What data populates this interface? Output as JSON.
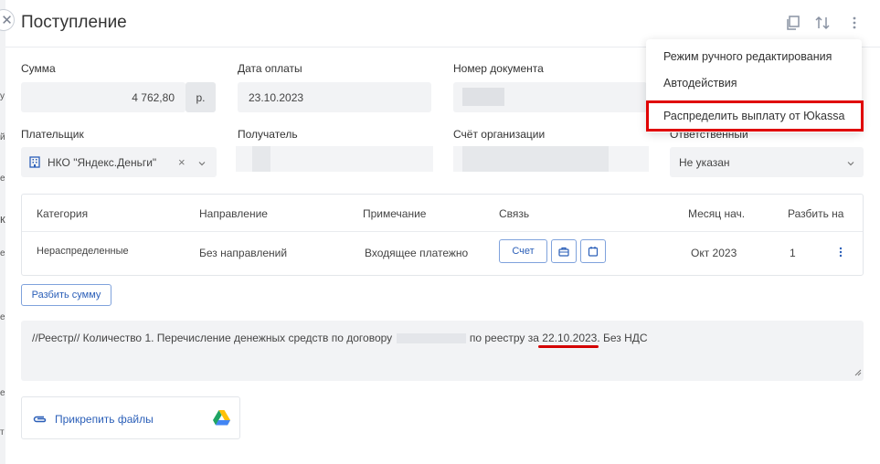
{
  "header": {
    "title": "Поступление",
    "close_icon": "close-icon",
    "copy_icon": "copy-icon",
    "sort_icon": "sort-arrows-icon",
    "more_icon": "more-vertical-icon"
  },
  "form": {
    "amount": {
      "label": "Сумма",
      "value": "4 762,80",
      "currency": "р."
    },
    "payment_date": {
      "label": "Дата оплаты",
      "value": "23.10.2023"
    },
    "doc_number": {
      "label": "Номер документа",
      "value": ""
    },
    "payer": {
      "label": "Плательщик",
      "value": "НКО \"Яндекс.Деньги\"",
      "clear": "×"
    },
    "recipient": {
      "label": "Получатель"
    },
    "org_account": {
      "label": "Счёт организации"
    },
    "responsible": {
      "label": "Ответственный",
      "value": "Не указан"
    }
  },
  "table": {
    "headers": [
      "Категория",
      "Направление",
      "Примечание",
      "Связь",
      "Месяц нач.",
      "Разбить на"
    ],
    "row": {
      "category": "Нераспределенные",
      "direction": "Без направлений",
      "note": "Входящее платежно",
      "link_button": "Счет",
      "month": "Окт 2023",
      "split": "1"
    }
  },
  "split_button": "Разбить сумму",
  "comment": {
    "part1": "//Реестр// Количество 1. Перечисление денежных средств по договору",
    "part2": "по реестру за",
    "date": "22.10.2023",
    "part3": ". Без НДС"
  },
  "attach": {
    "label": "Прикрепить файлы"
  },
  "menu": {
    "items": [
      "Режим ручного редактирования",
      "Автодействия",
      "Распределить выплату от Юkassa"
    ]
  },
  "colors": {
    "accent": "#2b5fb8",
    "highlight": "#e00000"
  }
}
